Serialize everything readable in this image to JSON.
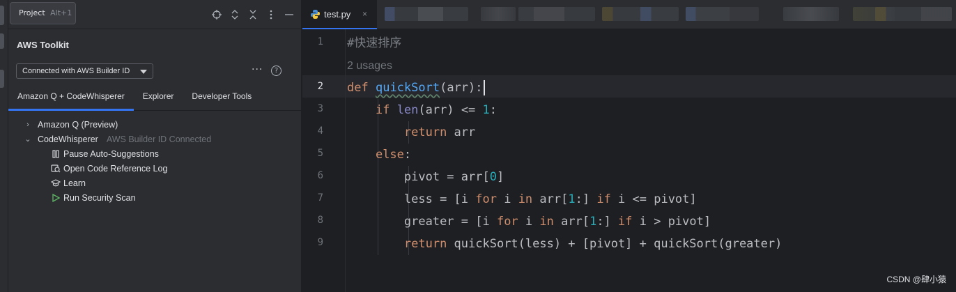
{
  "left_panel": {
    "project_tab": {
      "label": "Project",
      "shortcut": "Alt+1"
    },
    "header_icons": [
      "crosshair-icon",
      "expand-all-icon",
      "collapse-all-icon",
      "more-vertical-icon",
      "minimize-icon"
    ],
    "title": "AWS Toolkit",
    "connection_dropdown": {
      "value": "Connected with AWS Builder ID"
    },
    "more_label": "···",
    "help_label": "?",
    "tabs": [
      {
        "label": "Amazon Q + CodeWhisperer",
        "active": true
      },
      {
        "label": "Explorer",
        "active": false
      },
      {
        "label": "Developer Tools",
        "active": false
      }
    ],
    "tree": {
      "amazon_q": {
        "label": "Amazon Q (Preview)",
        "chevron": "›"
      },
      "codewhisperer": {
        "label": "CodeWhisperer",
        "status": "AWS Builder ID Connected",
        "chevron": "⌄"
      },
      "children": [
        {
          "label": "Pause Auto-Suggestions",
          "icon": "pause-icon"
        },
        {
          "label": "Open Code Reference Log",
          "icon": "reference-log-icon"
        },
        {
          "label": "Learn",
          "icon": "graduation-cap-icon"
        },
        {
          "label": "Run Security Scan",
          "icon": "play-icon"
        }
      ]
    }
  },
  "editor": {
    "active_tab": {
      "label": "test.py",
      "close": "×"
    },
    "line_numbers": [
      "1",
      "2",
      "3",
      "4",
      "5",
      "6",
      "7",
      "8",
      "9"
    ],
    "code": {
      "comment": "#快速排序",
      "usages": "2 usages",
      "l2_def": "def",
      "l2_fn": "quickSort",
      "l2_rest": "(arr):",
      "l3_if": "if",
      "l3_len": "len",
      "l3_mid": "(arr) <= ",
      "l3_num": "1",
      "l3_end": ":",
      "l4_return": "return",
      "l4_rest": " arr",
      "l5_else": "else",
      "l5_end": ":",
      "l6_a": "pivot = arr[",
      "l6_num": "0",
      "l6_b": "]",
      "l7_a": "less = [i ",
      "l7_for": "for",
      "l7_b": " i ",
      "l7_in": "in",
      "l7_c": " arr[",
      "l7_num": "1",
      "l7_d": ":] ",
      "l7_if": "if",
      "l7_e": " i <= pivot]",
      "l8_a": "greater = [i ",
      "l8_for": "for",
      "l8_b": " i ",
      "l8_in": "in",
      "l8_c": " arr[",
      "l8_num": "1",
      "l8_d": ":] ",
      "l8_if": "if",
      "l8_e": " i > pivot]",
      "l9_return": "return",
      "l9_rest": " quickSort(less) + [pivot] + quickSort(greater)"
    }
  },
  "watermark": "CSDN @肆小猿",
  "colors": {
    "accent": "#3574f0",
    "keyword": "#cf8e6d",
    "function": "#56a8f5",
    "builtin": "#8888c6",
    "number": "#2aacb8",
    "comment": "#7a7e85"
  }
}
